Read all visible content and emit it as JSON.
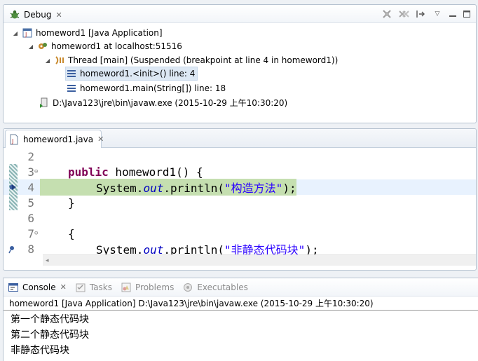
{
  "debug": {
    "tab_label": "Debug",
    "tree": [
      {
        "label": "homeword1 [Java Application]",
        "icon": "java-app-icon"
      },
      {
        "label": "homeword1 at localhost:51516",
        "icon": "debug-target-icon"
      },
      {
        "label": "Thread [main] (Suspended (breakpoint at line 4 in homeword1))",
        "icon": "thread-suspended-icon"
      },
      {
        "label": "homeword1.<init>() line: 4",
        "icon": "stack-frame-icon"
      },
      {
        "label": "homeword1.main(String[]) line: 18",
        "icon": "stack-frame-icon"
      },
      {
        "label": "D:\\Java123\\jre\\bin\\javaw.exe (2015-10-29 上午10:30:20)",
        "icon": "process-icon"
      }
    ]
  },
  "editor": {
    "tab_label": "homeword1.java",
    "lines": [
      {
        "num": "2"
      },
      {
        "num": "3"
      },
      {
        "num": "4"
      },
      {
        "num": "5"
      },
      {
        "num": "6"
      },
      {
        "num": "7"
      },
      {
        "num": "8"
      }
    ],
    "code": {
      "l3_kw": "public",
      "l3_rest": " homeword1() {",
      "l4_a": "System.",
      "l4_field": "out",
      "l4_b": ".println(",
      "l4_str": "\"构造方法\"",
      "l4_c": ");",
      "l5": "}",
      "l7": "{",
      "l8_a": "System.",
      "l8_field": "out",
      "l8_b": ".println(",
      "l8_str": "\"非静态代码块\"",
      "l8_c": ");"
    }
  },
  "console": {
    "tabs": [
      "Console",
      "Tasks",
      "Problems",
      "Executables"
    ],
    "header": "homeword1 [Java Application] D:\\Java123\\jre\\bin\\javaw.exe (2015-10-29 上午10:30:20)",
    "output": [
      "第一个静态代码块",
      "第二个静态代码块",
      "非静态代码块"
    ]
  },
  "colors": {
    "keyword": "#7f0055",
    "string": "#2a00ff",
    "field": "#0000c0",
    "current_line": "#c5dfb0"
  }
}
